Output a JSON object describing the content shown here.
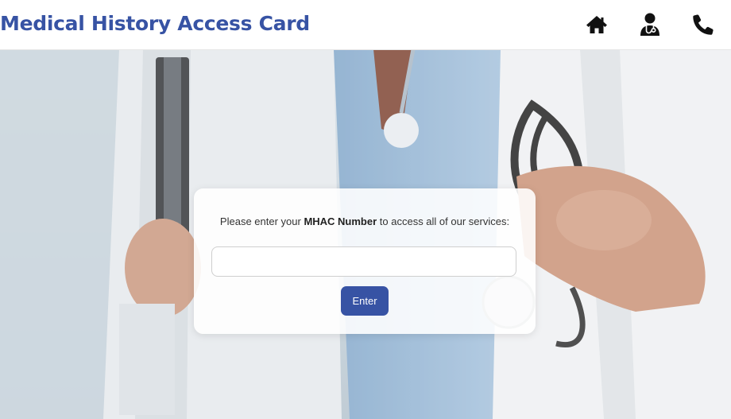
{
  "header": {
    "title": "Medical History Access Card",
    "nav": [
      {
        "icon": "home-icon"
      },
      {
        "icon": "doctor-icon"
      },
      {
        "icon": "phone-icon"
      }
    ]
  },
  "card": {
    "prompt_before": "Please enter your ",
    "prompt_bold": "MHAC Number",
    "prompt_after": " to access all of our services:",
    "input_value": "",
    "input_placeholder": "",
    "button_label": "Enter"
  },
  "colors": {
    "brand": "#3753a4",
    "icon": "#111111"
  }
}
